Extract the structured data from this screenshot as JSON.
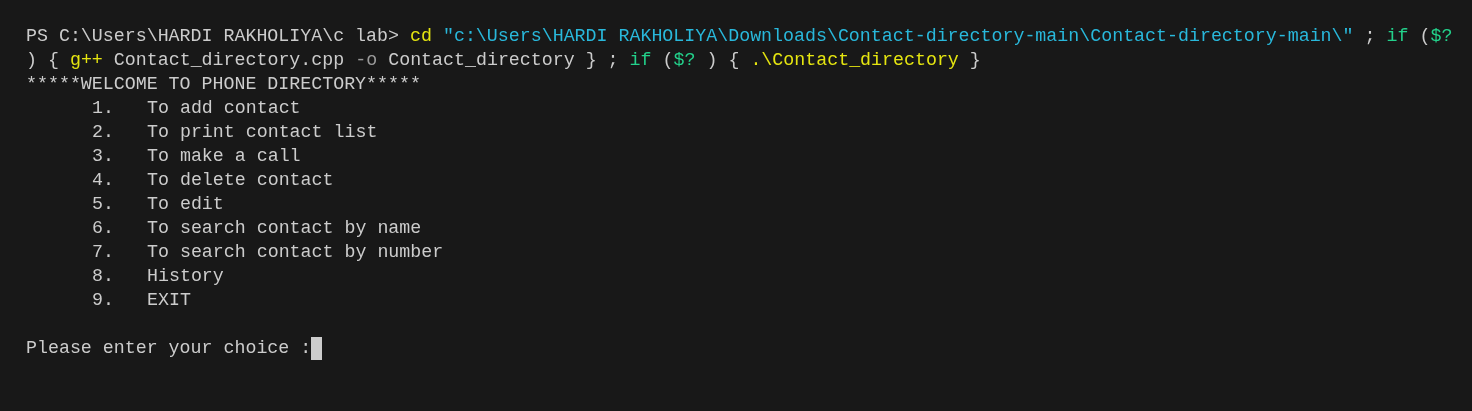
{
  "command_lines": [
    {
      "segments": [
        {
          "kind": "prompt",
          "text": "PS C:\\Users\\HARDI RAKHOLIYA\\c lab>"
        },
        {
          "kind": "command",
          "text": "cd"
        },
        {
          "kind": "string",
          "text": "\"c:\\Users\\HARDI RAKHOLIYA\\Downloads\\Contact-directory-main\\Contact-directory-main\\\""
        },
        {
          "kind": "plain",
          "text": ";"
        },
        {
          "kind": "keyword",
          "text": "if"
        },
        {
          "kind": "plain",
          "text": "("
        },
        {
          "kind": "keyword",
          "text": "$?"
        }
      ]
    },
    {
      "segments": [
        {
          "kind": "plain",
          "text": ") {"
        },
        {
          "kind": "command",
          "text": "g++"
        },
        {
          "kind": "plain",
          "text": "Contact_directory.cpp"
        },
        {
          "kind": "param",
          "text": "-o"
        },
        {
          "kind": "plain",
          "text": "Contact_directory } ;"
        },
        {
          "kind": "keyword",
          "text": "if"
        },
        {
          "kind": "plain",
          "text": "("
        },
        {
          "kind": "keyword",
          "text": "$?"
        },
        {
          "kind": "plain",
          "text": ") {"
        },
        {
          "kind": "command",
          "text": ".\\Contact_directory"
        },
        {
          "kind": "plain",
          "text": "}"
        }
      ]
    }
  ],
  "banner": "*****WELCOME TO PHONE DIRECTORY*****",
  "menu": [
    {
      "number": "1.",
      "label": "To add contact"
    },
    {
      "number": "2.",
      "label": "To print contact list"
    },
    {
      "number": "3.",
      "label": "To make a call"
    },
    {
      "number": "4.",
      "label": "To delete contact"
    },
    {
      "number": "5.",
      "label": "To edit"
    },
    {
      "number": "6.",
      "label": "To search contact by name"
    },
    {
      "number": "7.",
      "label": "To search contact by number"
    },
    {
      "number": "8.",
      "label": "History"
    },
    {
      "number": "9.",
      "label": "EXIT"
    }
  ],
  "input_prompt": "Please enter your choice :"
}
